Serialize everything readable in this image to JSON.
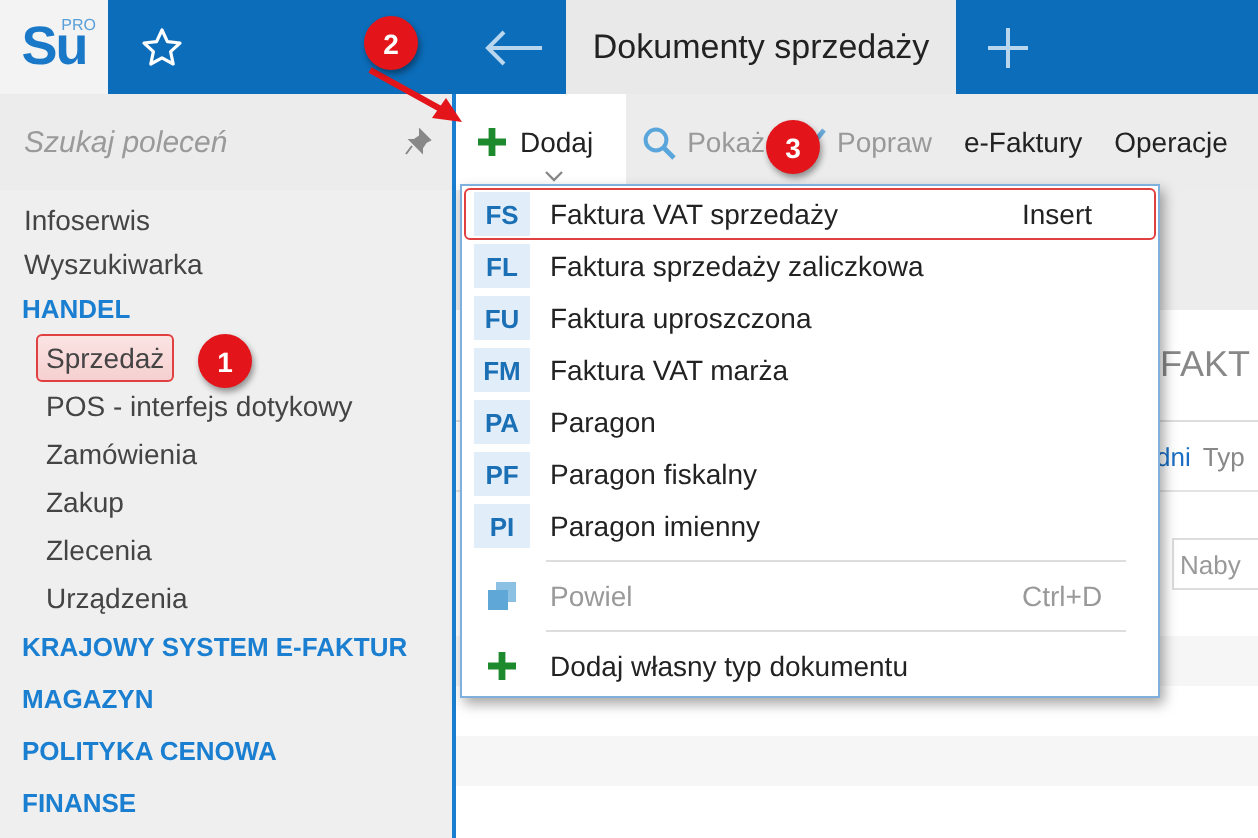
{
  "app": {
    "logo": "Su",
    "logo_badge": "PRO"
  },
  "tabs": [
    {
      "label": "Dokumenty sprzedaży",
      "selected": true
    }
  ],
  "search": {
    "placeholder": "Szukaj poleceń"
  },
  "toolbar": [
    {
      "label": "Dodaj",
      "disabled": false,
      "expanded": true
    },
    {
      "label": "Pokaż",
      "disabled": true,
      "expanded": false
    },
    {
      "label": "Popraw",
      "disabled": true,
      "expanded": false
    },
    {
      "label": "e-Faktury",
      "disabled": false,
      "expanded": false
    },
    {
      "label": "Operacje",
      "disabled": false,
      "expanded": false
    }
  ],
  "sidebar": {
    "items": [
      {
        "label": "Infoserwis",
        "kind": "link",
        "highlighted": false
      },
      {
        "label": "Wyszukiwarka",
        "kind": "link",
        "highlighted": false
      },
      {
        "label": "HANDEL",
        "kind": "group",
        "children": [
          {
            "label": "Sprzedaż",
            "kind": "link",
            "highlighted": true
          },
          {
            "label": "POS - interfejs dotykowy",
            "kind": "link",
            "highlighted": false
          },
          {
            "label": "Zamówienia",
            "kind": "link",
            "highlighted": false
          },
          {
            "label": "Zakup",
            "kind": "link",
            "highlighted": false
          },
          {
            "label": "Zlecenia",
            "kind": "link",
            "highlighted": false
          },
          {
            "label": "Urządzenia",
            "kind": "link",
            "highlighted": false
          }
        ]
      },
      {
        "label": "KRAJOWY SYSTEM E-FAKTUR",
        "kind": "group"
      },
      {
        "label": "MAGAZYN",
        "kind": "group"
      },
      {
        "label": "POLITYKA CENOWA",
        "kind": "group"
      },
      {
        "label": "FINANSE",
        "kind": "group"
      }
    ]
  },
  "background": {
    "tab_label": "FAKT",
    "link": "dni",
    "column": "Typ",
    "field_placeholder": "Naby"
  },
  "menu": [
    {
      "kind": "document",
      "code": "FS",
      "label": "Faktura VAT sprzedaży",
      "shortcut": "Insert",
      "highlighted": true,
      "disabled": false
    },
    {
      "kind": "document",
      "code": "FL",
      "label": "Faktura sprzedaży zaliczkowa",
      "highlighted": false,
      "disabled": false
    },
    {
      "kind": "document",
      "code": "FU",
      "label": "Faktura uproszczona",
      "highlighted": false,
      "disabled": false
    },
    {
      "kind": "document",
      "code": "FM",
      "label": "Faktura VAT marża",
      "highlighted": false,
      "disabled": false
    },
    {
      "kind": "document",
      "code": "PA",
      "label": "Paragon",
      "highlighted": false,
      "disabled": false
    },
    {
      "kind": "document",
      "code": "PF",
      "label": "Paragon fiskalny",
      "highlighted": false,
      "disabled": false
    },
    {
      "kind": "document",
      "code": "PI",
      "label": "Paragon imienny",
      "highlighted": false,
      "disabled": false
    },
    {
      "kind": "duplicate",
      "label": "Powiel",
      "shortcut": "Ctrl+D",
      "highlighted": false,
      "disabled": true
    },
    {
      "kind": "add",
      "label": "Dodaj własny typ dokumentu",
      "highlighted": false,
      "disabled": false
    }
  ],
  "annotations": [
    {
      "number": "1"
    },
    {
      "number": "2"
    },
    {
      "number": "3"
    }
  ]
}
